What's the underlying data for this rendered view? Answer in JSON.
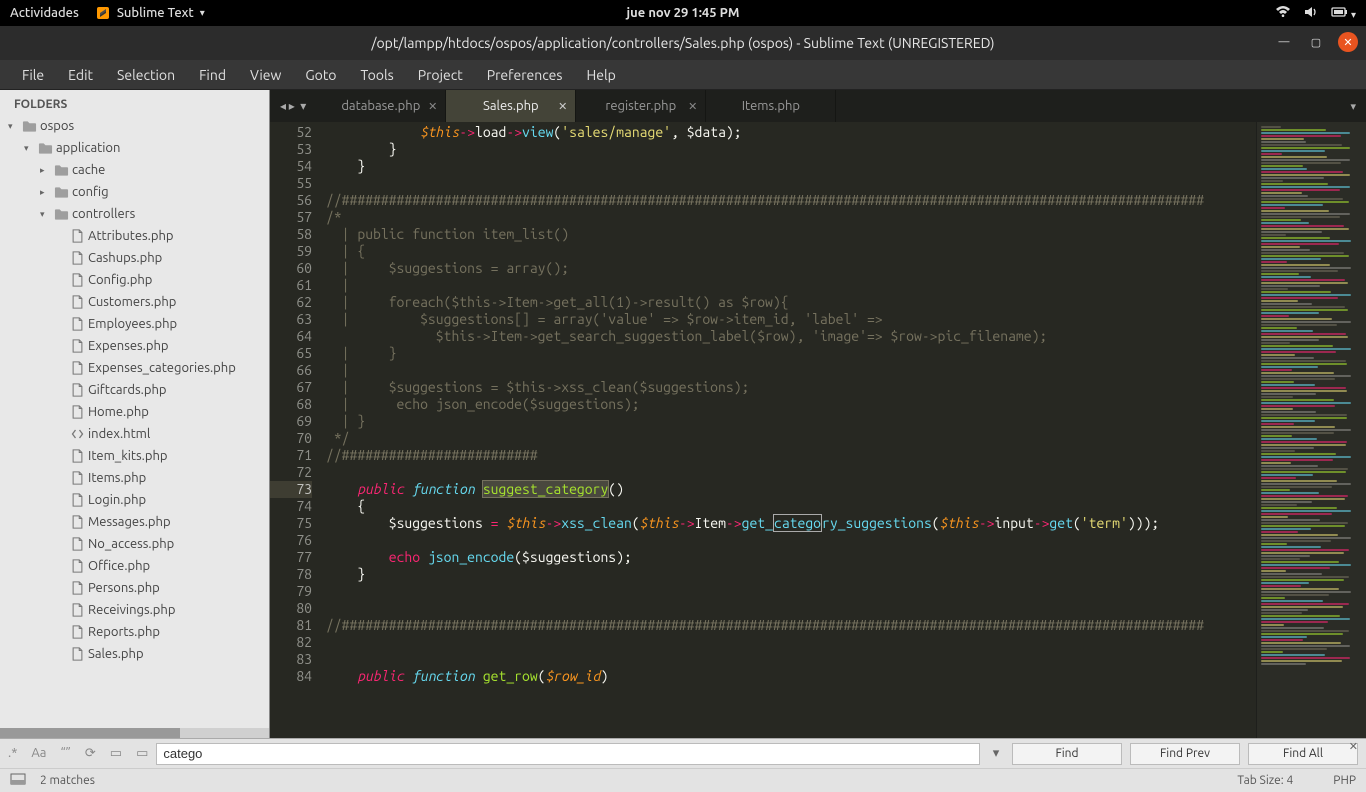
{
  "gnome": {
    "activities": "Actividades",
    "app_name": "Sublime Text",
    "datetime": "jue nov 29  1:45 PM"
  },
  "window": {
    "title": "/opt/lampp/htdocs/ospos/application/controllers/Sales.php (ospos) - Sublime Text (UNREGISTERED)"
  },
  "menubar": [
    "File",
    "Edit",
    "Selection",
    "Find",
    "View",
    "Goto",
    "Tools",
    "Project",
    "Preferences",
    "Help"
  ],
  "sidebar": {
    "heading": "FOLDERS",
    "tree": [
      {
        "depth": 0,
        "tri": "▾",
        "icon": "folder",
        "label": "ospos"
      },
      {
        "depth": 1,
        "tri": "▾",
        "icon": "folder",
        "label": "application"
      },
      {
        "depth": 2,
        "tri": "▸",
        "icon": "folder",
        "label": "cache"
      },
      {
        "depth": 2,
        "tri": "▸",
        "icon": "folder",
        "label": "config"
      },
      {
        "depth": 2,
        "tri": "▾",
        "icon": "folder",
        "label": "controllers"
      },
      {
        "depth": 3,
        "tri": "",
        "icon": "file",
        "label": "Attributes.php"
      },
      {
        "depth": 3,
        "tri": "",
        "icon": "file",
        "label": "Cashups.php"
      },
      {
        "depth": 3,
        "tri": "",
        "icon": "file",
        "label": "Config.php"
      },
      {
        "depth": 3,
        "tri": "",
        "icon": "file",
        "label": "Customers.php"
      },
      {
        "depth": 3,
        "tri": "",
        "icon": "file",
        "label": "Employees.php"
      },
      {
        "depth": 3,
        "tri": "",
        "icon": "file",
        "label": "Expenses.php"
      },
      {
        "depth": 3,
        "tri": "",
        "icon": "file",
        "label": "Expenses_categories.php"
      },
      {
        "depth": 3,
        "tri": "",
        "icon": "file",
        "label": "Giftcards.php"
      },
      {
        "depth": 3,
        "tri": "",
        "icon": "file",
        "label": "Home.php"
      },
      {
        "depth": 3,
        "tri": "",
        "icon": "code",
        "label": "index.html"
      },
      {
        "depth": 3,
        "tri": "",
        "icon": "file",
        "label": "Item_kits.php"
      },
      {
        "depth": 3,
        "tri": "",
        "icon": "file",
        "label": "Items.php"
      },
      {
        "depth": 3,
        "tri": "",
        "icon": "file",
        "label": "Login.php"
      },
      {
        "depth": 3,
        "tri": "",
        "icon": "file",
        "label": "Messages.php"
      },
      {
        "depth": 3,
        "tri": "",
        "icon": "file",
        "label": "No_access.php"
      },
      {
        "depth": 3,
        "tri": "",
        "icon": "file",
        "label": "Office.php"
      },
      {
        "depth": 3,
        "tri": "",
        "icon": "file",
        "label": "Persons.php"
      },
      {
        "depth": 3,
        "tri": "",
        "icon": "file",
        "label": "Receivings.php"
      },
      {
        "depth": 3,
        "tri": "",
        "icon": "file",
        "label": "Reports.php"
      },
      {
        "depth": 3,
        "tri": "",
        "icon": "file",
        "label": "Sales.php"
      }
    ]
  },
  "tabs": [
    {
      "label": "database.php",
      "active": false,
      "close": true
    },
    {
      "label": "Sales.php",
      "active": true,
      "close": true
    },
    {
      "label": "register.php",
      "active": false,
      "close": true
    },
    {
      "label": "Items.php",
      "active": false,
      "close": false
    }
  ],
  "gutter": {
    "start": 52,
    "end": 84,
    "highlight": 73
  },
  "find": {
    "text": "catego",
    "find_label": "Find",
    "find_prev_label": "Find Prev",
    "find_all_label": "Find All"
  },
  "status": {
    "matches": "2 matches",
    "tabsize": "Tab Size: 4",
    "lang": "PHP"
  }
}
